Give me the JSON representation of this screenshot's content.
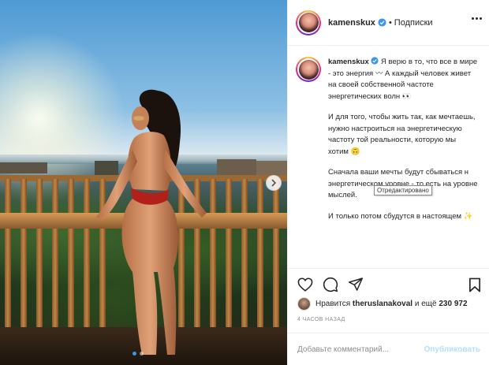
{
  "post": {
    "image_alt": "photo",
    "carousel": {
      "dot_count": 2,
      "active_index": 0
    }
  },
  "header": {
    "username": "kamenskux",
    "separator": "•",
    "follow_label": "Подписки"
  },
  "caption": {
    "username": "kamenskux",
    "para1": "Я верю в то, что все в мире - это энергия 〰 А каждый человек живет на своей собственной частоте энергетических волн 👀",
    "para2": "И для того, чтобы жить так, как мечтаешь, нужно настроиться на энергетическую частоту той реальности, которую мы хотим 🙃",
    "para3_part1": "Сначала ваши мечты будут сбываться н",
    "para3_part2": "энергетическом уровне - то есть на уровне мыслей.",
    "para4": "И только потом сбудутся в настоящем ✨",
    "tooltip": "Отредактировано"
  },
  "likes": {
    "prefix": "Нравится",
    "user": "theruslanakoval",
    "conjunction": "и ещё",
    "count": "230 972"
  },
  "time": "4 ЧАСОВ НАЗАД",
  "comment": {
    "placeholder": "Добавьте комментарий...",
    "publish_label": "Опубликовать"
  },
  "colors": {
    "accent": "#3897f0",
    "publish_disabled": "#b2dffc",
    "text": "#262626",
    "muted": "#8e8e8e"
  }
}
